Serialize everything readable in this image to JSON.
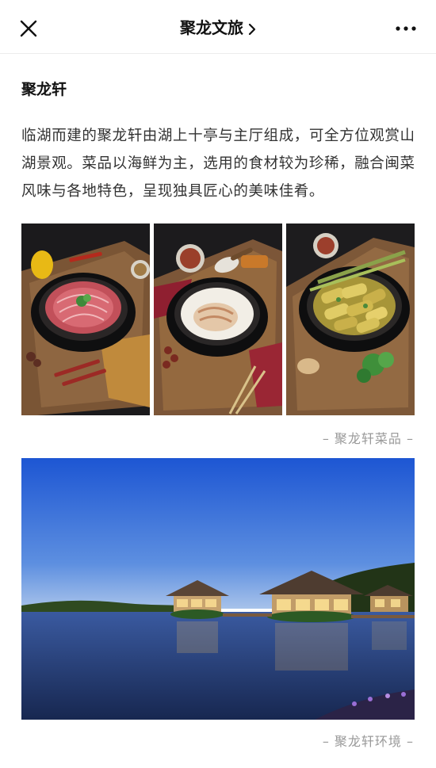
{
  "nav": {
    "title": "聚龙文旅",
    "close_icon": "close-icon",
    "chevron_icon": "chevron-right-icon",
    "more_icon": "more-dots-icon"
  },
  "article": {
    "heading": "聚龙轩",
    "paragraph": "临湖而建的聚龙轩由湖上十亭与主厅组成，可全方位观赏山湖景观。菜品以海鲜为主，选用的食材较为珍稀，融合闽菜风味与各地特色，呈现独具匠心的美味佳肴。"
  },
  "gallery": {
    "caption": "– 聚龙轩菜品 –"
  },
  "environment": {
    "caption": "– 聚龙轩环境 –"
  }
}
